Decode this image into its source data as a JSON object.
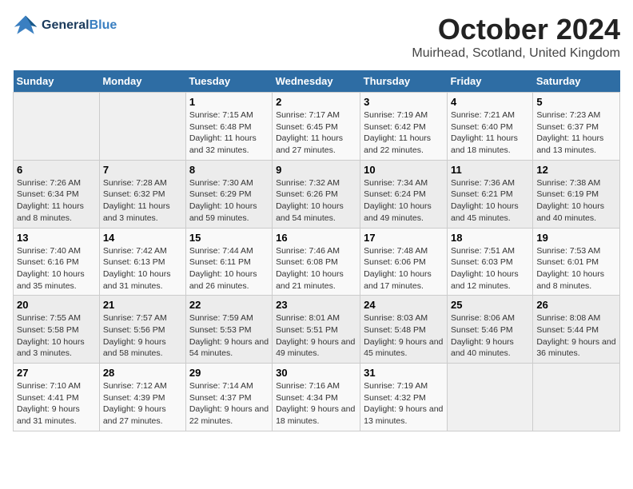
{
  "header": {
    "logo_line1": "General",
    "logo_line2": "Blue",
    "month": "October 2024",
    "location": "Muirhead, Scotland, United Kingdom"
  },
  "days_of_week": [
    "Sunday",
    "Monday",
    "Tuesday",
    "Wednesday",
    "Thursday",
    "Friday",
    "Saturday"
  ],
  "weeks": [
    [
      {
        "day": "",
        "info": ""
      },
      {
        "day": "",
        "info": ""
      },
      {
        "day": "1",
        "info": "Sunrise: 7:15 AM\nSunset: 6:48 PM\nDaylight: 11 hours and 32 minutes."
      },
      {
        "day": "2",
        "info": "Sunrise: 7:17 AM\nSunset: 6:45 PM\nDaylight: 11 hours and 27 minutes."
      },
      {
        "day": "3",
        "info": "Sunrise: 7:19 AM\nSunset: 6:42 PM\nDaylight: 11 hours and 22 minutes."
      },
      {
        "day": "4",
        "info": "Sunrise: 7:21 AM\nSunset: 6:40 PM\nDaylight: 11 hours and 18 minutes."
      },
      {
        "day": "5",
        "info": "Sunrise: 7:23 AM\nSunset: 6:37 PM\nDaylight: 11 hours and 13 minutes."
      }
    ],
    [
      {
        "day": "6",
        "info": "Sunrise: 7:26 AM\nSunset: 6:34 PM\nDaylight: 11 hours and 8 minutes."
      },
      {
        "day": "7",
        "info": "Sunrise: 7:28 AM\nSunset: 6:32 PM\nDaylight: 11 hours and 3 minutes."
      },
      {
        "day": "8",
        "info": "Sunrise: 7:30 AM\nSunset: 6:29 PM\nDaylight: 10 hours and 59 minutes."
      },
      {
        "day": "9",
        "info": "Sunrise: 7:32 AM\nSunset: 6:26 PM\nDaylight: 10 hours and 54 minutes."
      },
      {
        "day": "10",
        "info": "Sunrise: 7:34 AM\nSunset: 6:24 PM\nDaylight: 10 hours and 49 minutes."
      },
      {
        "day": "11",
        "info": "Sunrise: 7:36 AM\nSunset: 6:21 PM\nDaylight: 10 hours and 45 minutes."
      },
      {
        "day": "12",
        "info": "Sunrise: 7:38 AM\nSunset: 6:19 PM\nDaylight: 10 hours and 40 minutes."
      }
    ],
    [
      {
        "day": "13",
        "info": "Sunrise: 7:40 AM\nSunset: 6:16 PM\nDaylight: 10 hours and 35 minutes."
      },
      {
        "day": "14",
        "info": "Sunrise: 7:42 AM\nSunset: 6:13 PM\nDaylight: 10 hours and 31 minutes."
      },
      {
        "day": "15",
        "info": "Sunrise: 7:44 AM\nSunset: 6:11 PM\nDaylight: 10 hours and 26 minutes."
      },
      {
        "day": "16",
        "info": "Sunrise: 7:46 AM\nSunset: 6:08 PM\nDaylight: 10 hours and 21 minutes."
      },
      {
        "day": "17",
        "info": "Sunrise: 7:48 AM\nSunset: 6:06 PM\nDaylight: 10 hours and 17 minutes."
      },
      {
        "day": "18",
        "info": "Sunrise: 7:51 AM\nSunset: 6:03 PM\nDaylight: 10 hours and 12 minutes."
      },
      {
        "day": "19",
        "info": "Sunrise: 7:53 AM\nSunset: 6:01 PM\nDaylight: 10 hours and 8 minutes."
      }
    ],
    [
      {
        "day": "20",
        "info": "Sunrise: 7:55 AM\nSunset: 5:58 PM\nDaylight: 10 hours and 3 minutes."
      },
      {
        "day": "21",
        "info": "Sunrise: 7:57 AM\nSunset: 5:56 PM\nDaylight: 9 hours and 58 minutes."
      },
      {
        "day": "22",
        "info": "Sunrise: 7:59 AM\nSunset: 5:53 PM\nDaylight: 9 hours and 54 minutes."
      },
      {
        "day": "23",
        "info": "Sunrise: 8:01 AM\nSunset: 5:51 PM\nDaylight: 9 hours and 49 minutes."
      },
      {
        "day": "24",
        "info": "Sunrise: 8:03 AM\nSunset: 5:48 PM\nDaylight: 9 hours and 45 minutes."
      },
      {
        "day": "25",
        "info": "Sunrise: 8:06 AM\nSunset: 5:46 PM\nDaylight: 9 hours and 40 minutes."
      },
      {
        "day": "26",
        "info": "Sunrise: 8:08 AM\nSunset: 5:44 PM\nDaylight: 9 hours and 36 minutes."
      }
    ],
    [
      {
        "day": "27",
        "info": "Sunrise: 7:10 AM\nSunset: 4:41 PM\nDaylight: 9 hours and 31 minutes."
      },
      {
        "day": "28",
        "info": "Sunrise: 7:12 AM\nSunset: 4:39 PM\nDaylight: 9 hours and 27 minutes."
      },
      {
        "day": "29",
        "info": "Sunrise: 7:14 AM\nSunset: 4:37 PM\nDaylight: 9 hours and 22 minutes."
      },
      {
        "day": "30",
        "info": "Sunrise: 7:16 AM\nSunset: 4:34 PM\nDaylight: 9 hours and 18 minutes."
      },
      {
        "day": "31",
        "info": "Sunrise: 7:19 AM\nSunset: 4:32 PM\nDaylight: 9 hours and 13 minutes."
      },
      {
        "day": "",
        "info": ""
      },
      {
        "day": "",
        "info": ""
      }
    ]
  ]
}
